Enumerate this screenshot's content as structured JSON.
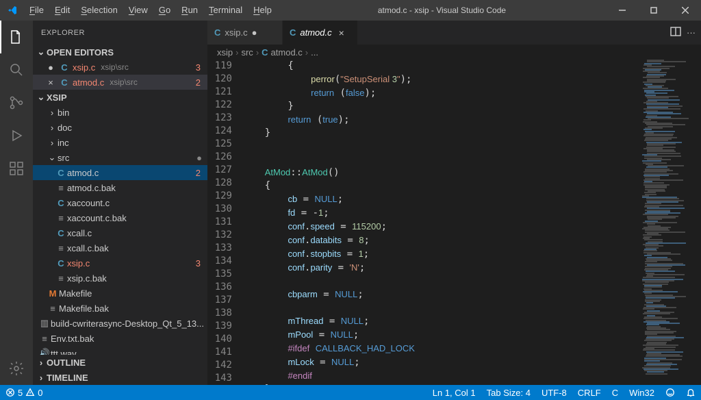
{
  "title": "atmod.c - xsip - Visual Studio Code",
  "menu": [
    "File",
    "Edit",
    "Selection",
    "View",
    "Go",
    "Run",
    "Terminal",
    "Help"
  ],
  "menuKeys": [
    "F",
    "E",
    "S",
    "V",
    "G",
    "R",
    "T",
    "H"
  ],
  "sidebarTitle": "EXPLORER",
  "sections": {
    "openEditors": "OPEN EDITORS",
    "project": "XSIP",
    "outline": "OUTLINE",
    "timeline": "TIMELINE"
  },
  "openEditors": [
    {
      "name": "xsip.c",
      "path": "xsip\\src",
      "badge": "3",
      "active": false,
      "dirty": true
    },
    {
      "name": "atmod.c",
      "path": "xsip\\src",
      "badge": "2",
      "active": true,
      "dirty": false
    }
  ],
  "tree": [
    {
      "type": "folder",
      "name": "bin",
      "indent": 1,
      "collapsed": true
    },
    {
      "type": "folder",
      "name": "doc",
      "indent": 1,
      "collapsed": true
    },
    {
      "type": "folder",
      "name": "inc",
      "indent": 1,
      "collapsed": true
    },
    {
      "type": "folder",
      "name": "src",
      "indent": 1,
      "collapsed": false,
      "mod": true
    },
    {
      "type": "file",
      "name": "atmod.c",
      "indent": 2,
      "icon": "C",
      "err": false,
      "selected": true,
      "badge": "2"
    },
    {
      "type": "file",
      "name": "atmod.c.bak",
      "indent": 2,
      "icon": "≡"
    },
    {
      "type": "file",
      "name": "xaccount.c",
      "indent": 2,
      "icon": "C"
    },
    {
      "type": "file",
      "name": "xaccount.c.bak",
      "indent": 2,
      "icon": "≡"
    },
    {
      "type": "file",
      "name": "xcall.c",
      "indent": 2,
      "icon": "C"
    },
    {
      "type": "file",
      "name": "xcall.c.bak",
      "indent": 2,
      "icon": "≡"
    },
    {
      "type": "file",
      "name": "xsip.c",
      "indent": 2,
      "icon": "C",
      "err": true,
      "badge": "3"
    },
    {
      "type": "file",
      "name": "xsip.c.bak",
      "indent": 2,
      "icon": "≡"
    },
    {
      "type": "file",
      "name": "Makefile",
      "indent": 1,
      "icon": "M"
    },
    {
      "type": "file",
      "name": "Makefile.bak",
      "indent": 1,
      "icon": "≡"
    },
    {
      "type": "file",
      "name": "build-cwriterasync-Desktop_Qt_5_13...",
      "indent": 0,
      "icon": "▣"
    },
    {
      "type": "file",
      "name": "Env.txt.bak",
      "indent": 0,
      "icon": "≡"
    },
    {
      "type": "file",
      "name": "ttt.wav",
      "indent": 0,
      "icon": "♪"
    }
  ],
  "tabs": [
    {
      "name": "xsip.c",
      "active": false,
      "dirty": true
    },
    {
      "name": "atmod.c",
      "active": true,
      "dirty": false
    }
  ],
  "breadcrumbs": [
    "xsip",
    "src",
    "atmod.c",
    "..."
  ],
  "lineStart": 119,
  "codeLines": [
    "        {",
    "            perror(\"SetupSerial 3\");",
    "            return (false);",
    "        }",
    "        return (true);",
    "    }",
    "",
    "",
    "    AtMod::AtMod()",
    "    {",
    "        cb = NULL;",
    "        fd = -1;",
    "        conf.speed = 115200;",
    "        conf.databits = 8;",
    "        conf.stopbits = 1;",
    "        conf.parity = 'N';",
    "",
    "        cbparm = NULL;",
    "",
    "        mThread = NULL;",
    "        mPool = NULL;",
    "        #ifdef CALLBACK_HAD_LOCK",
    "        mLock = NULL;",
    "        #endif",
    "    }"
  ],
  "status": {
    "errors": "5",
    "warnings": "0",
    "pos": "Ln 1, Col 1",
    "spaces": "Tab Size: 4",
    "encoding": "UTF-8",
    "eol": "CRLF",
    "lang": "C",
    "os": "Win32"
  }
}
